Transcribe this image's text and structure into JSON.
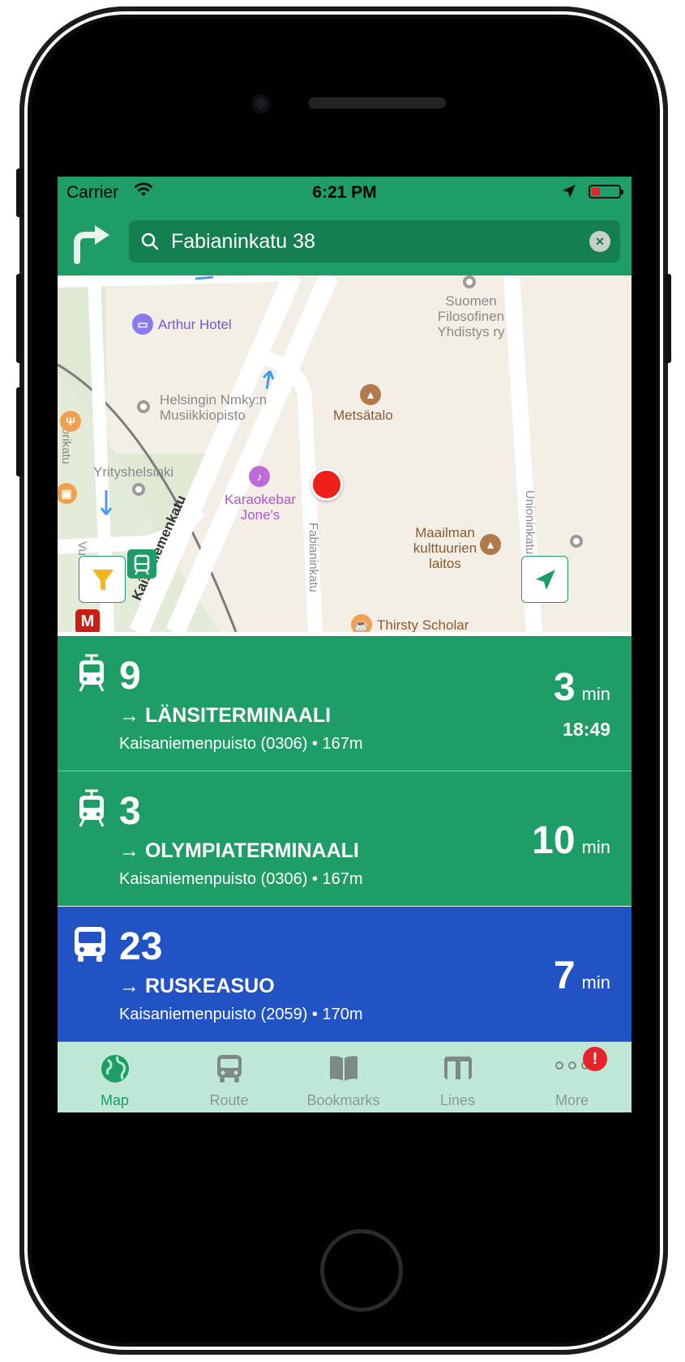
{
  "status_bar": {
    "carrier": "Carrier",
    "time": "6:21 PM"
  },
  "search": {
    "value": "Fabianinkatu 38"
  },
  "map": {
    "labels": {
      "arthur_hotel": "Arthur Hotel",
      "suomen": "Suomen\nFilosofinen\nYhdistys ry",
      "nmky": "Helsingin Nmky:n\nMusiikkiopisto",
      "metsatalo": "Metsätalo",
      "vuorikatu": "Vuorikatu",
      "yrityshelsinki": "Yrityshelsinki",
      "karaokebar": "Karaokebar\nJone's",
      "fabianinkatu": "Fabianinkatu",
      "maailman": "Maailman\nkulttuurien\nlaitos",
      "unioninkatu": "Unioninkatu",
      "kaisaniemenkatu": "Kaisaniemenkatu",
      "thirsty": "Thirsty Scholar",
      "vu": "Vu",
      "metro": "M"
    },
    "colors": {
      "background": "#f3efe6",
      "road": "#ffffff",
      "park": "#dfe9d4",
      "pin": "#ee1f18"
    }
  },
  "departures": [
    {
      "vehicle": "tram-icon",
      "line": "9",
      "destination": "→ LÄNSITERMINAALI",
      "stop": "Kaisaniemenpuisto (0306) • 167m",
      "minutes": "3",
      "unit": "min",
      "clock": "18:49",
      "color": "#1f9d66"
    },
    {
      "vehicle": "tram-icon",
      "line": "3",
      "destination": "→ OLYMPIATERMINAALI",
      "stop": "Kaisaniemenpuisto (0306) • 167m",
      "minutes": "10",
      "unit": "min",
      "clock": "",
      "color": "#1f9d66"
    },
    {
      "vehicle": "bus-icon",
      "line": "23",
      "destination": "→ RUSKEASUO",
      "stop": "Kaisaniemenpuisto (2059) • 170m",
      "minutes": "7",
      "unit": "min",
      "clock": "",
      "color": "#2253c5"
    }
  ],
  "tabs": [
    {
      "label": "Map",
      "icon": "globe-icon",
      "active": true
    },
    {
      "label": "Route",
      "icon": "bus-icon",
      "active": false
    },
    {
      "label": "Bookmarks",
      "icon": "book-icon",
      "active": false
    },
    {
      "label": "Lines",
      "icon": "lines-icon",
      "active": false
    },
    {
      "label": "More",
      "icon": "more-icon",
      "active": false,
      "badge": "!"
    }
  ],
  "brand_colors": {
    "primary": "#1f9d66",
    "bus": "#2253c5",
    "tab_bg": "#bfe9d6"
  }
}
